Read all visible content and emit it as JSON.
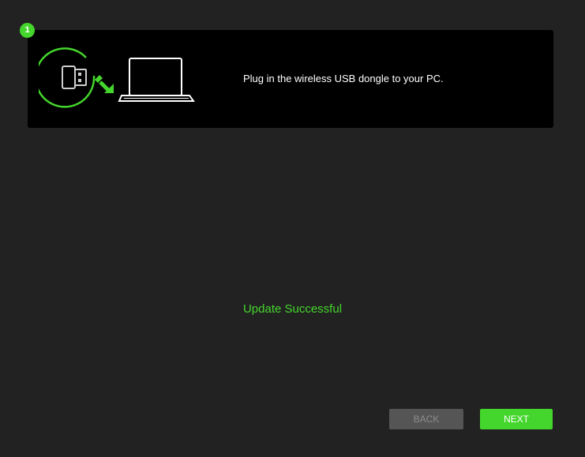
{
  "step": {
    "number": "1",
    "instruction": "Plug in the wireless USB dongle to your PC.",
    "illustration_icons": [
      "usb-dongle-icon",
      "arrow-icon",
      "laptop-icon"
    ]
  },
  "status": {
    "message": "Update Successful"
  },
  "buttons": {
    "back_label": "BACK",
    "next_label": "NEXT"
  },
  "colors": {
    "accent": "#44d62c",
    "background": "#222222",
    "card": "#000000",
    "button_disabled": "#555555"
  }
}
